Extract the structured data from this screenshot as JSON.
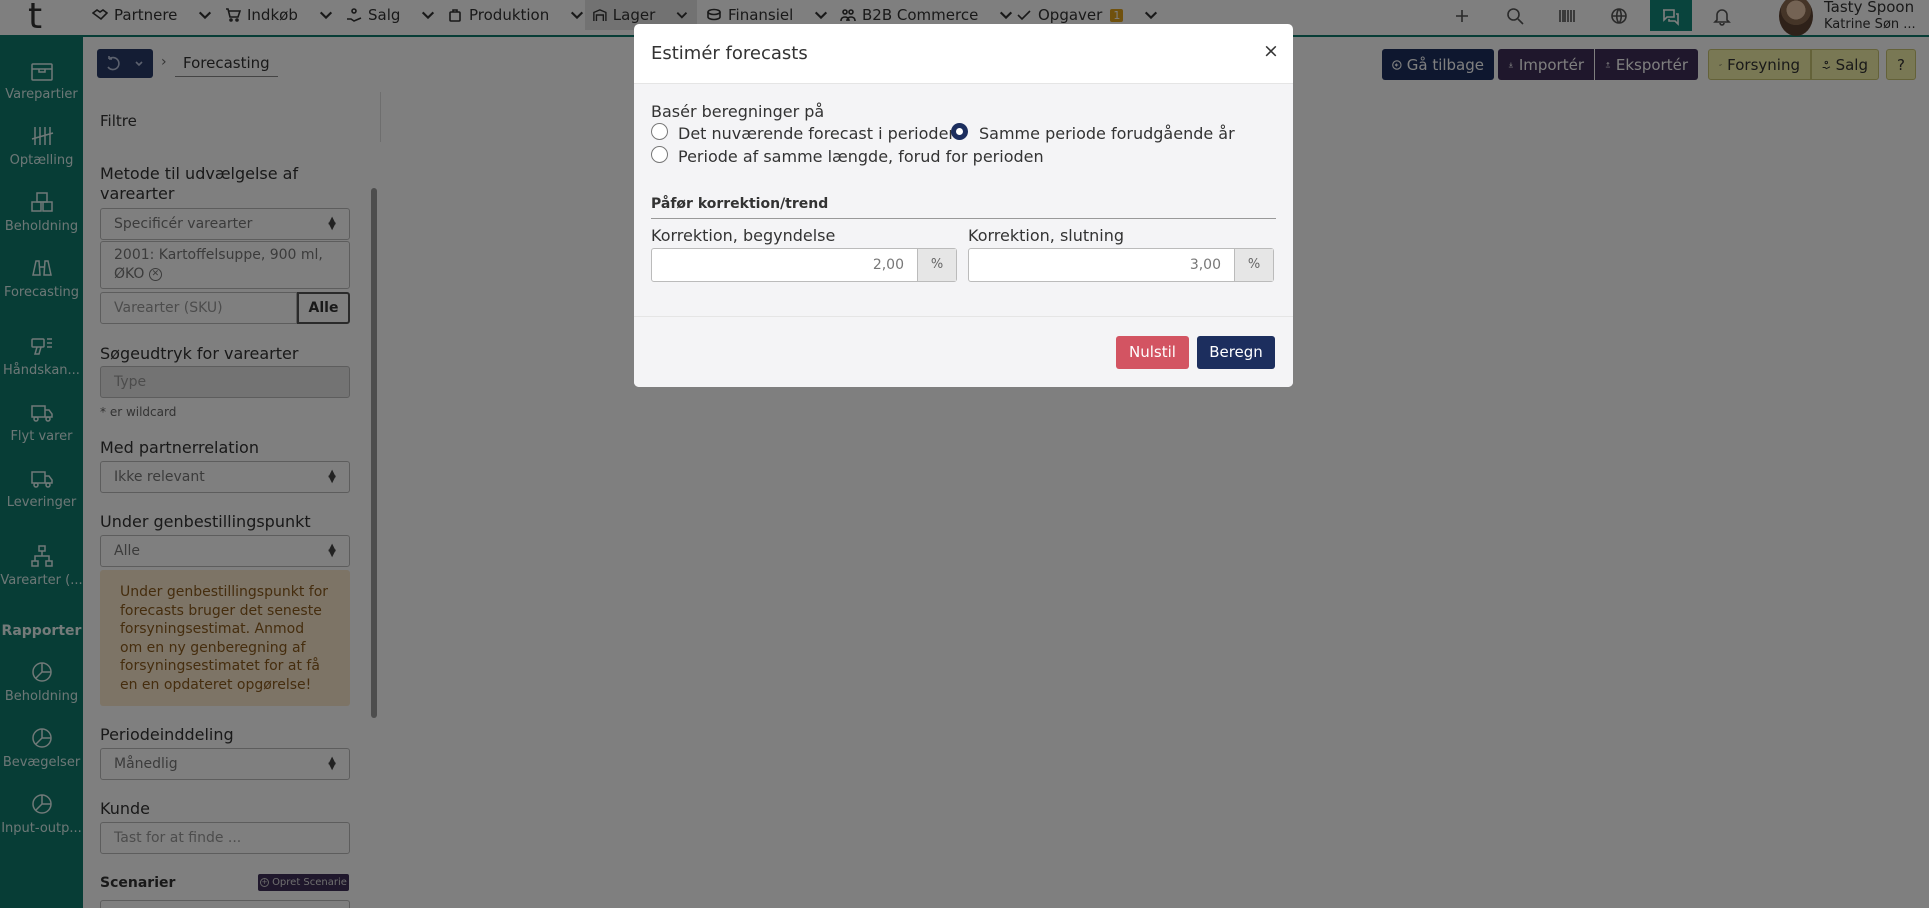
{
  "app": {
    "logo": "t"
  },
  "nav": {
    "items": [
      {
        "label": "Partnere",
        "icon": "handshake-icon"
      },
      {
        "label": "Indkøb",
        "icon": "cart-icon"
      },
      {
        "label": "Salg",
        "icon": "hand-coin-icon"
      },
      {
        "label": "Produktion",
        "icon": "pot-icon"
      },
      {
        "label": "Lager",
        "icon": "warehouse-icon"
      },
      {
        "label": "Finansiel",
        "icon": "coins-icon"
      },
      {
        "label": "B2B Commerce",
        "icon": "people-icon"
      },
      {
        "label": "Opgaver",
        "icon": "check-icon",
        "badge": "1"
      }
    ]
  },
  "user": {
    "company": "Tasty Spoon",
    "name": "Katrine Søn ..."
  },
  "sidebar": {
    "items": [
      {
        "label": "Varepartier",
        "icon": "box-icon"
      },
      {
        "label": "Optælling",
        "icon": "tally-icon"
      },
      {
        "label": "Beholdning",
        "icon": "boxes-icon"
      },
      {
        "label": "Forecasting",
        "icon": "binoculars-icon"
      },
      {
        "label": "Håndskan...",
        "icon": "scanner-icon"
      },
      {
        "label": "Flyt varer",
        "icon": "truck-move-icon"
      },
      {
        "label": "Leveringer",
        "icon": "truck-icon"
      },
      {
        "label": "Varearter (...",
        "icon": "hierarchy-icon"
      }
    ],
    "reports_heading": "Rapporter",
    "reports": [
      {
        "label": "Beholdning",
        "icon": "pie-chart-icon"
      },
      {
        "label": "Bevægelser",
        "icon": "pie-chart-icon"
      },
      {
        "label": "Input-outp...",
        "icon": "pie-chart-icon"
      }
    ]
  },
  "breadcrumb": {
    "current": "Forecasting"
  },
  "toolbar": {
    "back": "Gå tilbage",
    "import": "Importér",
    "export": "Eksportér",
    "supply": "Forsyning",
    "sales": "Salg",
    "help": "?"
  },
  "filters": {
    "title": "Filtre",
    "method_label": "Metode til udvælgelse af varearter",
    "method_value": "Specificér varearter",
    "selected_item": "2001: Kartoffelsuppe, 900 ml, ØKO",
    "sku_placeholder": "Varearter (SKU)",
    "sku_all": "Alle",
    "search_label": "Søgeudtryk for varearter",
    "search_placeholder": "Type",
    "wildcard_hint": "* er wildcard",
    "partner_label": "Med partnerrelation",
    "partner_value": "Ikke relevant",
    "reorder_label": "Under genbestillingspunkt",
    "reorder_value": "Alle",
    "reorder_warning": "Under genbestillingspunkt for forecasts bruger det seneste forsyningsestimat. Anmod om en ny genberegning af forsyningsestimatet for at få en en opdateret opgørelse!",
    "period_label": "Periodeinddeling",
    "period_value": "Månedlig",
    "customer_label": "Kunde",
    "customer_placeholder": "Tast for at finde ...",
    "scenarios_label": "Scenarier",
    "create_scenario": "Opret Scenarie"
  },
  "modal": {
    "title": "Estimér forecasts",
    "close": "×",
    "base_label": "Basér beregninger på",
    "options": [
      {
        "label": "Det nuværende forecast i perioden",
        "selected": false
      },
      {
        "label": "Samme periode forudgående år",
        "selected": true
      },
      {
        "label": "Periode af samme længde, forud for perioden",
        "selected": false
      }
    ],
    "correction_heading": "Påfør korrektion/trend",
    "start_label": "Korrektion, begyndelse",
    "start_value": "2,00",
    "end_label": "Korrektion, slutning",
    "end_value": "3,00",
    "unit": "%",
    "reset": "Nulstil",
    "calculate": "Beregn"
  },
  "colors": {
    "sidebar": "#0f7a6c",
    "navy": "#1c2e5e",
    "purple": "#3e2f58",
    "yellow": "#f3f0a8",
    "danger": "#d35462",
    "warning_bg": "#fbe8cc"
  }
}
